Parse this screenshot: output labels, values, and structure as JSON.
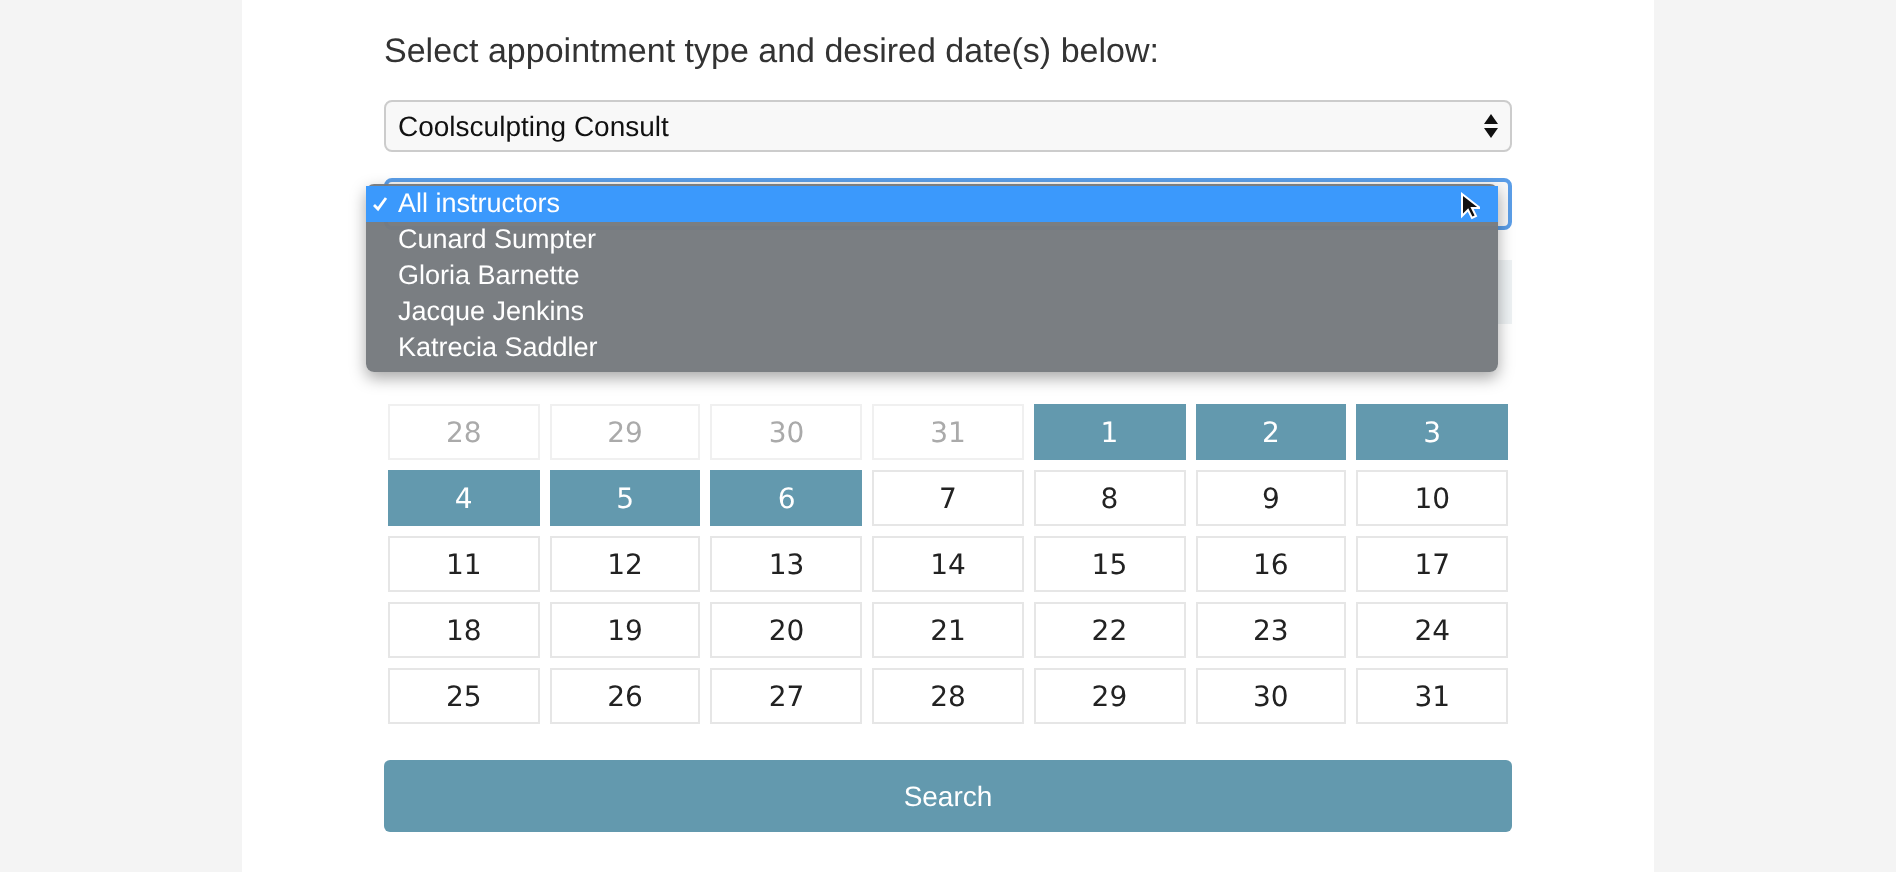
{
  "heading": "Select appointment type and desired date(s) below:",
  "appointment_select": {
    "value": "Coolsculpting Consult"
  },
  "instructor_select": {
    "options": [
      {
        "label": "All instructors",
        "selected": true
      },
      {
        "label": "Cunard Sumpter",
        "selected": false
      },
      {
        "label": "Gloria Barnette",
        "selected": false
      },
      {
        "label": "Jacque Jenkins",
        "selected": false
      },
      {
        "label": "Katrecia Saddler",
        "selected": false
      }
    ]
  },
  "calendar": {
    "days": [
      {
        "label": "28",
        "kind": "other"
      },
      {
        "label": "29",
        "kind": "other"
      },
      {
        "label": "30",
        "kind": "other"
      },
      {
        "label": "31",
        "kind": "other"
      },
      {
        "label": "1",
        "kind": "available"
      },
      {
        "label": "2",
        "kind": "available"
      },
      {
        "label": "3",
        "kind": "available"
      },
      {
        "label": "4",
        "kind": "available"
      },
      {
        "label": "5",
        "kind": "available"
      },
      {
        "label": "6",
        "kind": "available"
      },
      {
        "label": "7",
        "kind": "day"
      },
      {
        "label": "8",
        "kind": "day"
      },
      {
        "label": "9",
        "kind": "day"
      },
      {
        "label": "10",
        "kind": "day"
      },
      {
        "label": "11",
        "kind": "day"
      },
      {
        "label": "12",
        "kind": "day"
      },
      {
        "label": "13",
        "kind": "day"
      },
      {
        "label": "14",
        "kind": "day"
      },
      {
        "label": "15",
        "kind": "day"
      },
      {
        "label": "16",
        "kind": "day"
      },
      {
        "label": "17",
        "kind": "day"
      },
      {
        "label": "18",
        "kind": "day"
      },
      {
        "label": "19",
        "kind": "day"
      },
      {
        "label": "20",
        "kind": "day"
      },
      {
        "label": "21",
        "kind": "day"
      },
      {
        "label": "22",
        "kind": "day"
      },
      {
        "label": "23",
        "kind": "day"
      },
      {
        "label": "24",
        "kind": "day"
      },
      {
        "label": "25",
        "kind": "day"
      },
      {
        "label": "26",
        "kind": "day"
      },
      {
        "label": "27",
        "kind": "day"
      },
      {
        "label": "28",
        "kind": "day"
      },
      {
        "label": "29",
        "kind": "day"
      },
      {
        "label": "30",
        "kind": "day"
      },
      {
        "label": "31",
        "kind": "day"
      }
    ]
  },
  "search_button": "Search"
}
